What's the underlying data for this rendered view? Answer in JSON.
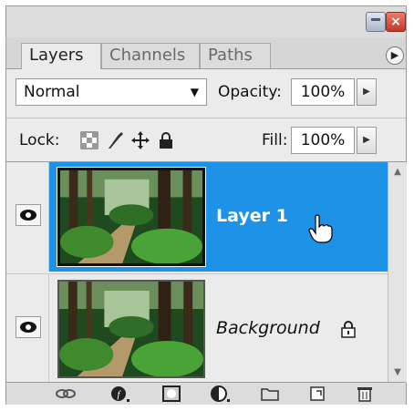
{
  "panel": {
    "tabs": [
      {
        "label": "Layers",
        "active": true
      },
      {
        "label": "Channels",
        "active": false
      },
      {
        "label": "Paths",
        "active": false
      }
    ],
    "menu_icon": "circle-right-arrow-icon"
  },
  "options": {
    "blend_mode": "Normal",
    "opacity_label": "Opacity:",
    "opacity_value": "100%",
    "lock_label": "Lock:",
    "fill_label": "Fill:",
    "fill_value": "100%"
  },
  "layers": [
    {
      "name": "Layer 1",
      "selected": true,
      "visible": true,
      "locked": false
    },
    {
      "name": "Background",
      "selected": false,
      "visible": true,
      "locked": true
    }
  ],
  "colors": {
    "selection": "#1e92e6",
    "panel_bg": "#ebebeb"
  },
  "bottom_icons": [
    "link-layers-icon",
    "layer-style-icon",
    "layer-mask-icon",
    "adjustment-layer-icon",
    "new-group-icon",
    "new-layer-icon",
    "delete-layer-icon"
  ]
}
